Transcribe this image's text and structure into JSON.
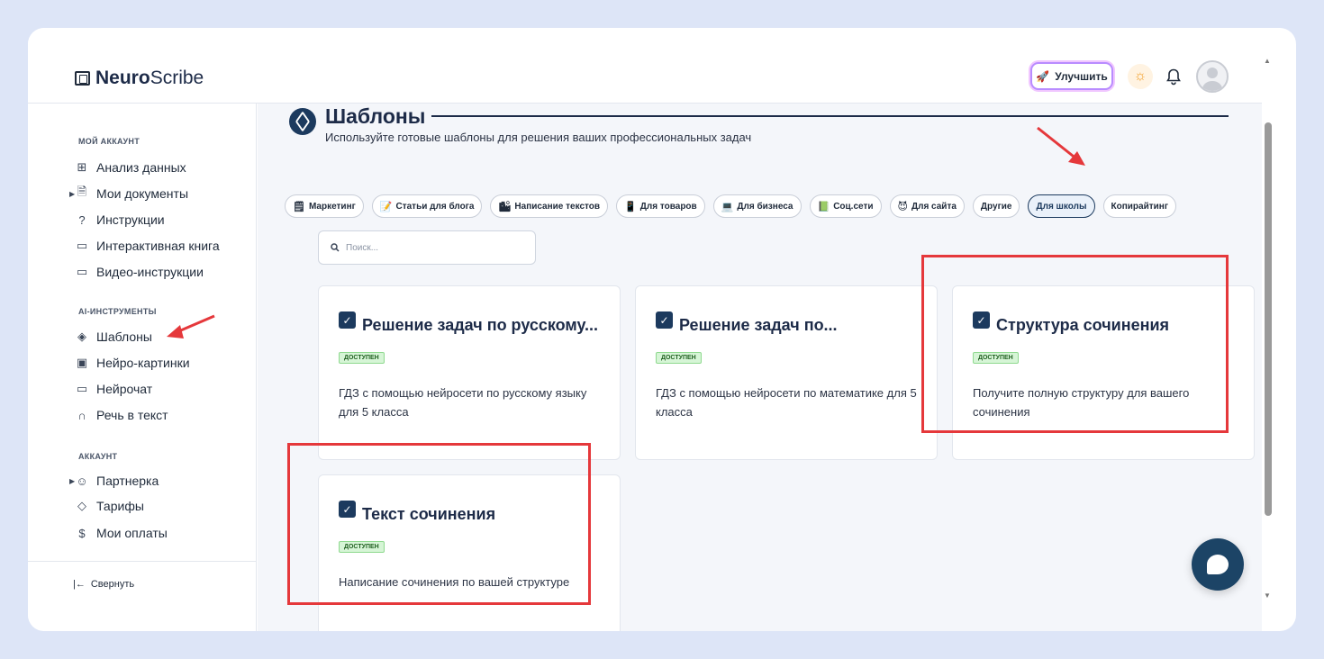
{
  "app": {
    "brand_bold": "Neuro",
    "brand_rest": "Scribe"
  },
  "header": {
    "upgrade_label": "Улучшить",
    "rocket_icon": "rocket-icon",
    "sun_icon": "sun-icon",
    "bell_icon": "bell-icon"
  },
  "sidebar": {
    "sections": [
      {
        "title": "МОЙ АККАУНТ",
        "items": [
          {
            "label": "Анализ данных",
            "icon": "grid-icon"
          },
          {
            "label": "Мои документы",
            "icon": "document-icon",
            "expandable": true
          },
          {
            "label": "Инструкции",
            "icon": "help-circle-icon"
          },
          {
            "label": "Интерактивная книга",
            "icon": "book-icon"
          },
          {
            "label": "Видео-инструкции",
            "icon": "video-icon"
          }
        ]
      },
      {
        "title": "AI-ИНСТРУМЕНТЫ",
        "items": [
          {
            "label": "Шаблоны",
            "icon": "layers-icon",
            "active": true
          },
          {
            "label": "Нейро-картинки",
            "icon": "image-icon"
          },
          {
            "label": "Нейрочат",
            "icon": "chat-icon"
          },
          {
            "label": "Речь в текст",
            "icon": "headphones-icon"
          }
        ]
      },
      {
        "title": "АККАУНТ",
        "items": [
          {
            "label": "Партнерка",
            "icon": "users-icon",
            "expandable": true
          },
          {
            "label": "Тарифы",
            "icon": "tag-icon"
          },
          {
            "label": "Мои оплаты",
            "icon": "dollar-icon"
          }
        ]
      }
    ],
    "collapse_label": "Свернуть"
  },
  "main": {
    "title": "Шаблоны",
    "subtitle": "Используйте готовые шаблоны для решения ваших профессиональных задач",
    "tabs": [
      {
        "label": "Маркетинг",
        "emoji": "🗒"
      },
      {
        "label": "Статьи для блога",
        "emoji": "📝"
      },
      {
        "label": "Написание текстов",
        "emoji": "🏙"
      },
      {
        "label": "Для товаров",
        "emoji": "📱"
      },
      {
        "label": "Для бизнеса",
        "emoji": "💻"
      },
      {
        "label": "Соц.сети",
        "emoji": "📗"
      },
      {
        "label": "Для сайта",
        "emoji": "😈"
      },
      {
        "label": "Другие",
        "emoji": ""
      },
      {
        "label": "Для школы",
        "emoji": "",
        "active": true
      },
      {
        "label": "Копирайтинг",
        "emoji": ""
      }
    ],
    "search_placeholder": "Поиск...",
    "cards": [
      {
        "title": "Решение задач по русскому...",
        "badge": "ДОСТУПЕН",
        "description": "ГДЗ с помощью нейросети по русскому языку для 5 класса"
      },
      {
        "title": "Решение задач по...",
        "badge": "ДОСТУПЕН",
        "description": "ГДЗ с помощью нейросети по математике для 5 класса"
      },
      {
        "title": "Структура сочинения",
        "badge": "ДОСТУПЕН",
        "description": "Получите полную структуру для вашего сочинения"
      },
      {
        "title": "Текст сочинения",
        "badge": "ДОСТУПЕН",
        "description": "Написание сочинения по вашей структуре"
      }
    ]
  },
  "colors": {
    "accent": "#1c3a5e",
    "highlight": "#e5383b",
    "badge_bg": "#d6f5d6"
  }
}
